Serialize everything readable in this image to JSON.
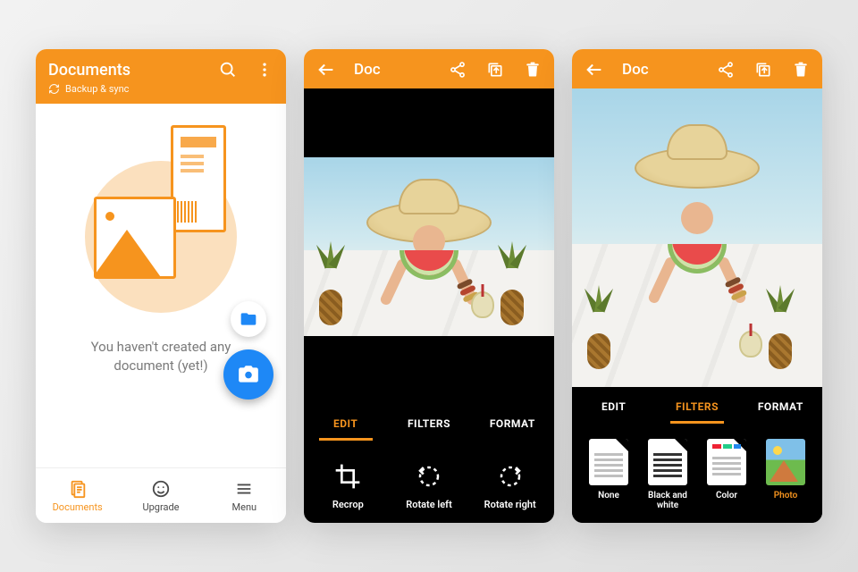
{
  "accent": "#f6941e",
  "blue": "#1e88f6",
  "panel1": {
    "title": "Documents",
    "sync_label": "Backup & sync",
    "empty_text": "You haven't created any document (yet!)",
    "nav": [
      {
        "label": "Documents",
        "active": true
      },
      {
        "label": "Upgrade",
        "active": false
      },
      {
        "label": "Menu",
        "active": false
      }
    ]
  },
  "panel2": {
    "title": "Doc",
    "tabs": [
      {
        "label": "EDIT",
        "active": true
      },
      {
        "label": "FILTERS",
        "active": false
      },
      {
        "label": "FORMAT",
        "active": false
      }
    ],
    "tools": [
      {
        "label": "Recrop"
      },
      {
        "label": "Rotate left"
      },
      {
        "label": "Rotate right"
      }
    ]
  },
  "panel3": {
    "title": "Doc",
    "tabs": [
      {
        "label": "EDIT",
        "active": false
      },
      {
        "label": "FILTERS",
        "active": true
      },
      {
        "label": "FORMAT",
        "active": false
      }
    ],
    "filters": [
      {
        "label": "None",
        "active": false
      },
      {
        "label": "Black and white",
        "active": false
      },
      {
        "label": "Color",
        "active": false
      },
      {
        "label": "Photo",
        "active": true
      }
    ]
  }
}
